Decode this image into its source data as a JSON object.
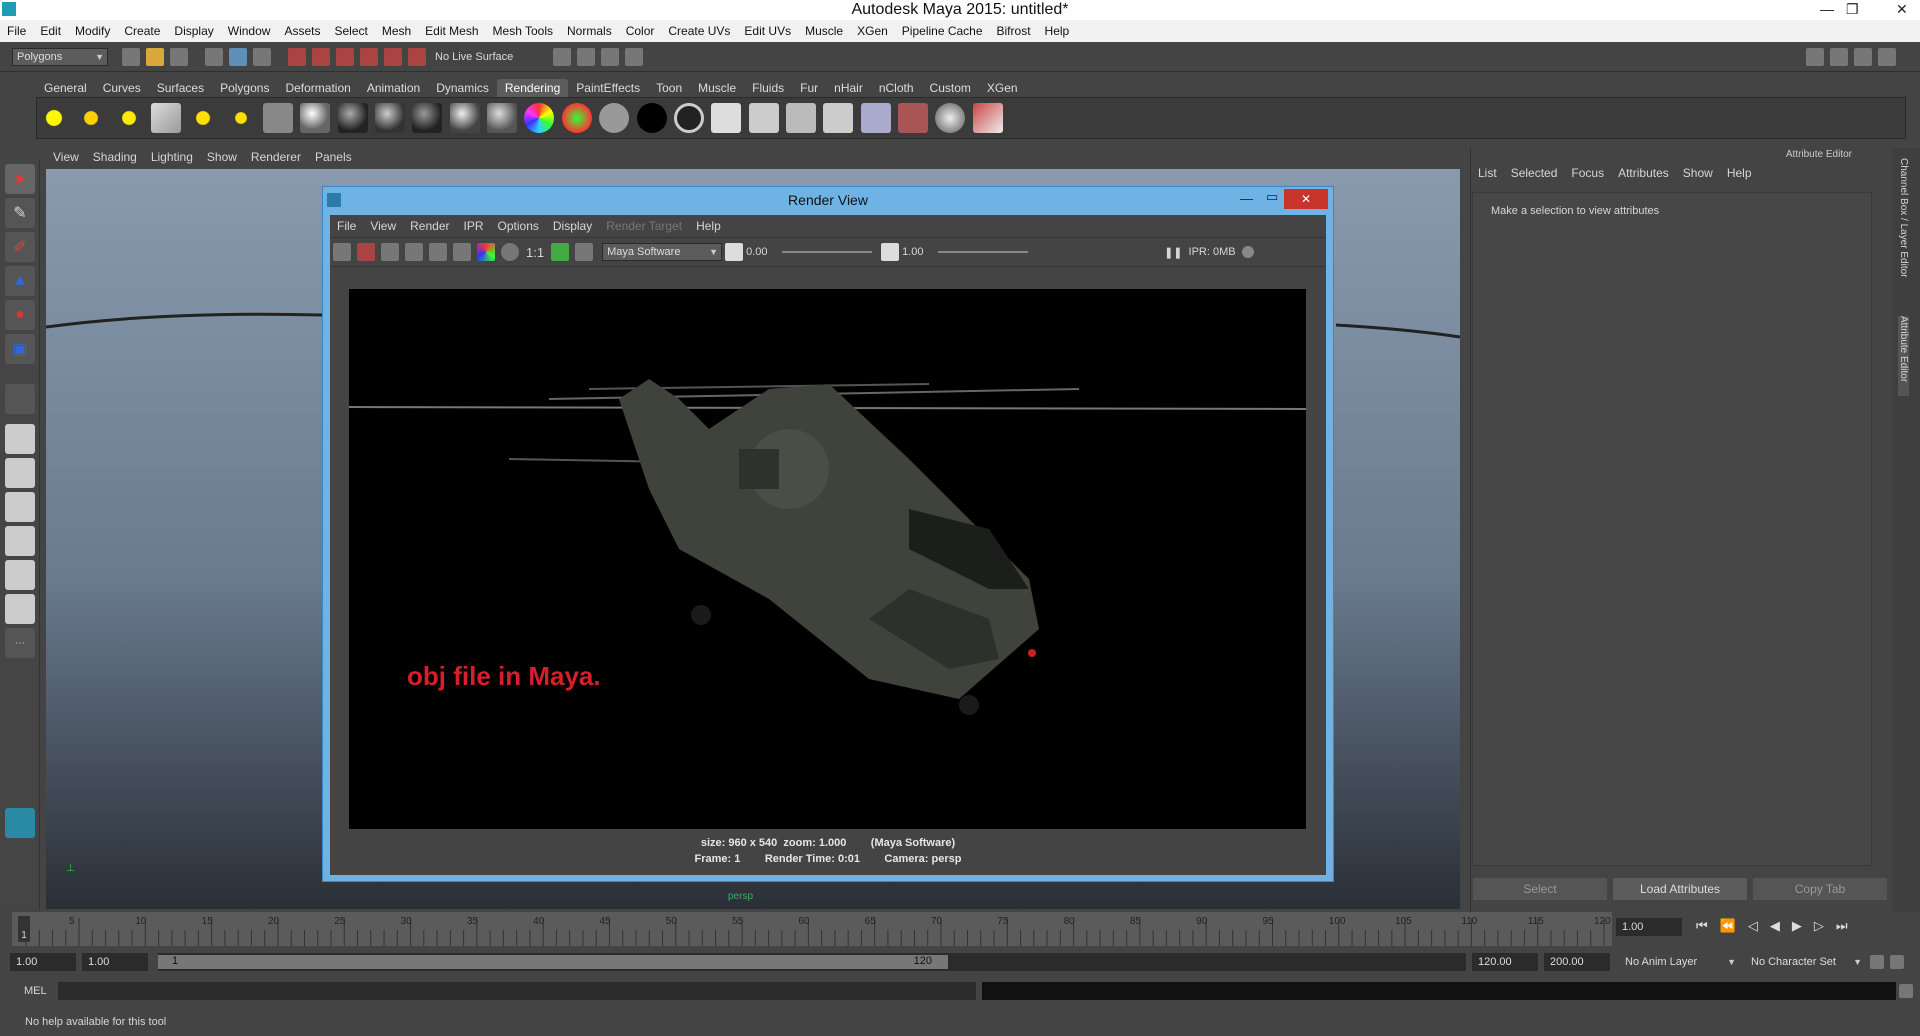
{
  "window": {
    "title": "Autodesk Maya 2015: untitled*",
    "minimize": "—",
    "restore": "❐",
    "close": "✕"
  },
  "menubar": [
    "File",
    "Edit",
    "Modify",
    "Create",
    "Display",
    "Window",
    "Assets",
    "Select",
    "Mesh",
    "Edit Mesh",
    "Mesh Tools",
    "Normals",
    "Color",
    "Create UVs",
    "Edit UVs",
    "Muscle",
    "XGen",
    "Pipeline Cache",
    "Bifrost",
    "Help"
  ],
  "statusline": {
    "menuset": "Polygons",
    "live_surface": "No Live Surface"
  },
  "shelf_tabs": [
    "General",
    "Curves",
    "Surfaces",
    "Polygons",
    "Deformation",
    "Animation",
    "Dynamics",
    "Rendering",
    "PaintEffects",
    "Toon",
    "Muscle",
    "Fluids",
    "Fur",
    "nHair",
    "nCloth",
    "Custom",
    "XGen"
  ],
  "shelf_active": "Rendering",
  "viewport": {
    "menu": [
      "View",
      "Shading",
      "Lighting",
      "Show",
      "Renderer",
      "Panels"
    ],
    "camera_label": "persp"
  },
  "render_view": {
    "title": "Render View",
    "menu": [
      "File",
      "View",
      "Render",
      "IPR",
      "Options",
      "Display",
      "Render Target",
      "Help"
    ],
    "renderer": "Maya Software",
    "exposure": "0.00",
    "gamma": "1.00",
    "ratio": "1:1",
    "ipr": "IPR: 0MB",
    "overlay_text": "obj file in Maya.",
    "info_line1": "size: 960 x 540  zoom: 1.000        (Maya Software)",
    "info_line2": "Frame: 1        Render Time: 0:01        Camera: persp"
  },
  "attribute_editor": {
    "header": "Attribute Editor",
    "menu": [
      "List",
      "Selected",
      "Focus",
      "Attributes",
      "Show",
      "Help"
    ],
    "message": "Make a selection to view attributes",
    "buttons": [
      "Select",
      "Load Attributes",
      "Copy Tab"
    ],
    "side_tabs": [
      "Channel Box / Layer Editor",
      "Attribute Editor"
    ]
  },
  "timeline": {
    "ticks": [
      "5",
      "10",
      "15",
      "20",
      "25",
      "30",
      "35",
      "40",
      "45",
      "50",
      "55",
      "60",
      "65",
      "70",
      "75",
      "80",
      "85",
      "90",
      "95",
      "100",
      "105",
      "110",
      "115",
      "120"
    ],
    "current": "1",
    "current_field": "1.00"
  },
  "range": {
    "start": "1.00",
    "start2": "1.00",
    "slider_start": "1",
    "slider_end": "120",
    "end": "120.00",
    "end2": "200.00",
    "anim_layer": "No Anim Layer",
    "char_set": "No Character Set"
  },
  "command_line": {
    "label": "MEL"
  },
  "help_line": "No help available for this tool"
}
